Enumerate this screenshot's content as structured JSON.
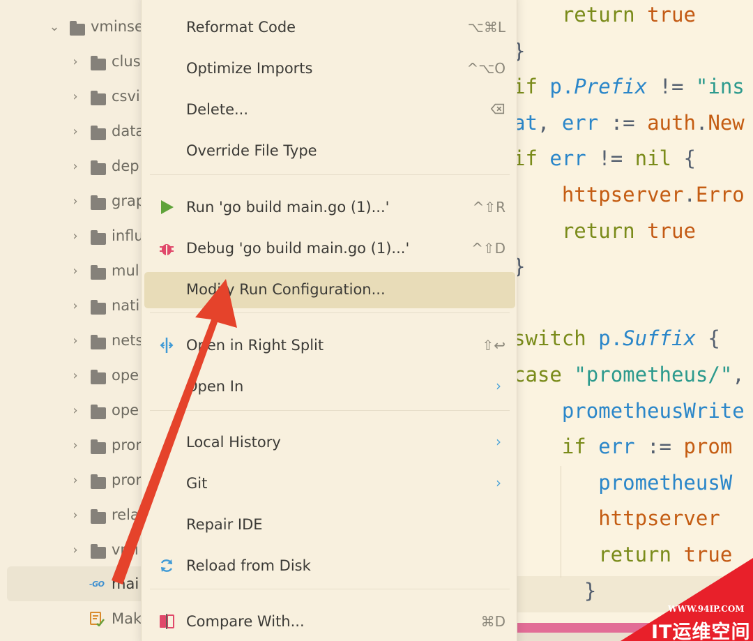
{
  "tree": {
    "root": {
      "label": "vminse"
    },
    "folders": [
      "clus",
      "csvi",
      "data",
      "dep",
      "grap",
      "influ",
      "mul",
      "nati",
      "nets",
      "ope",
      "ope",
      "pror",
      "pror",
      "rela",
      "vmi"
    ],
    "files": [
      {
        "icon": "go-file-icon",
        "badge": "GO",
        "label": "mai"
      },
      {
        "icon": "makefile-icon",
        "label": "Mak"
      }
    ]
  },
  "menu": {
    "items": [
      {
        "label": "Reformat Code",
        "shortcut": "⌥⌘L"
      },
      {
        "label": "Optimize Imports",
        "shortcut": "^⌥O"
      },
      {
        "label": "Delete...",
        "shortcut_icon": "delete-key-icon"
      },
      {
        "label": "Override File Type"
      },
      {
        "label": "Run 'go build main.go (1)...'",
        "shortcut": "^⇧R",
        "icon": "run-icon"
      },
      {
        "label": "Debug 'go build main.go (1)...'",
        "shortcut": "^⇧D",
        "icon": "debug-icon"
      },
      {
        "label": "Modify Run Configuration...",
        "active": true
      },
      {
        "label": "Open in Right Split",
        "shortcut": "⇧↩",
        "icon": "split-icon"
      },
      {
        "label": "Open In",
        "submenu": true
      },
      {
        "label": "Local History",
        "submenu": true
      },
      {
        "label": "Git",
        "submenu": true
      },
      {
        "label": "Repair IDE"
      },
      {
        "label": "Reload from Disk",
        "icon": "reload-icon"
      },
      {
        "label": "Compare With...",
        "shortcut": "⌘D",
        "icon": "compare-icon"
      }
    ]
  },
  "editor": {
    "lines": [
      [
        [
          "kw",
          "    return "
        ],
        [
          "val",
          "true"
        ]
      ],
      [
        [
          "op",
          "}"
        ]
      ],
      [
        [
          "kw",
          "if "
        ],
        [
          "id",
          "p."
        ],
        [
          "it",
          "Prefix"
        ],
        [
          "op",
          " != "
        ],
        [
          "str",
          "\"ins"
        ]
      ],
      [
        [
          "id",
          "at"
        ],
        [
          "op",
          ", "
        ],
        [
          "id",
          "err"
        ],
        [
          "op",
          " := "
        ],
        [
          "pkg",
          "auth"
        ],
        [
          "op",
          "."
        ],
        [
          "fn",
          "New"
        ]
      ],
      [
        [
          "kw",
          "if "
        ],
        [
          "id",
          "err"
        ],
        [
          "op",
          " != "
        ],
        [
          "kw",
          "nil"
        ],
        [
          "op",
          " {"
        ]
      ],
      [
        [
          "pkg",
          "    httpserver"
        ],
        [
          "op",
          "."
        ],
        [
          "fn",
          "Erro"
        ]
      ],
      [
        [
          "kw",
          "    return "
        ],
        [
          "val",
          "true"
        ]
      ],
      [
        [
          "op",
          "}"
        ]
      ],
      [
        [
          "op",
          ""
        ]
      ],
      [
        [
          "kw",
          "switch "
        ],
        [
          "id",
          "p."
        ],
        [
          "it",
          "Suffix"
        ],
        [
          "op",
          " {"
        ]
      ],
      [
        [
          "kw",
          "case "
        ],
        [
          "str",
          "\"prometheus/\""
        ],
        [
          "op",
          ","
        ]
      ],
      [
        [
          "id",
          "    prometheusWrite"
        ]
      ],
      [
        [
          "kw",
          "    if "
        ],
        [
          "id",
          "err"
        ],
        [
          "op",
          " := "
        ],
        [
          "fn",
          "prom"
        ]
      ],
      [
        [
          "id",
          "       prometheusW"
        ]
      ],
      [
        [
          "pkg",
          "       httpserver"
        ]
      ],
      [
        [
          "kw",
          "       return "
        ],
        [
          "val",
          "true"
        ]
      ],
      [
        [
          "op",
          "    }"
        ]
      ]
    ]
  },
  "watermark": {
    "url": "WWW.94IP.COM",
    "text": "IT运维空间"
  },
  "colors": {
    "arrow": "#e5432b",
    "selection": "#e8dcb8",
    "watermark": "#e8202a"
  }
}
